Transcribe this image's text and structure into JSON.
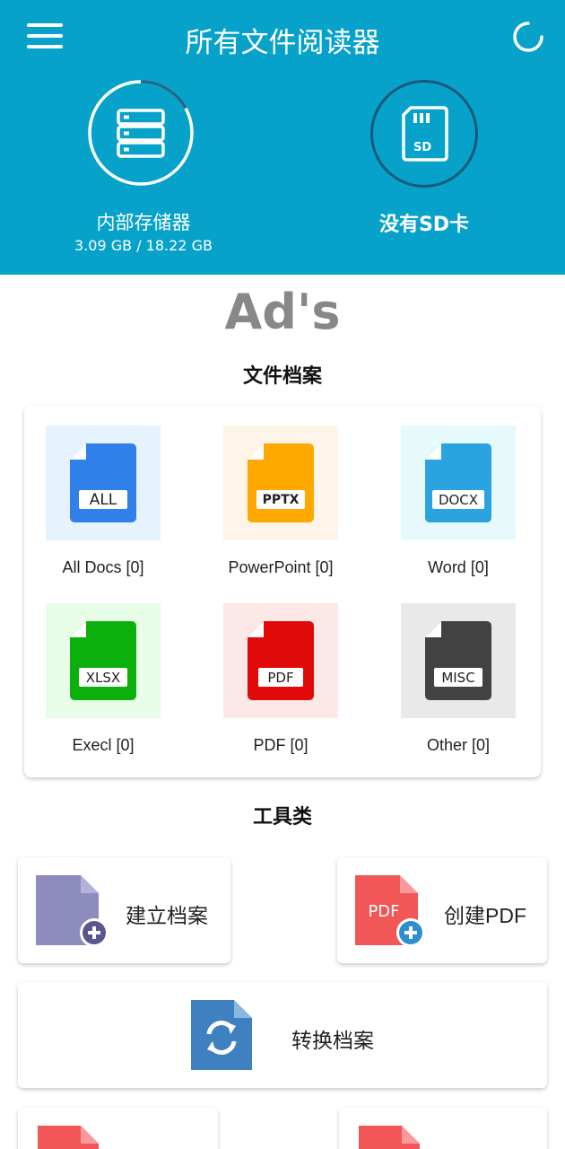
{
  "header": {
    "title": "所有文件阅读器",
    "background": "#07a2ca"
  },
  "storage": {
    "internal": {
      "label": "内部存储器",
      "usage": "3.09  GB / 18.22  GB",
      "used_fraction": 0.17
    },
    "sd": {
      "label": "没有SD卡",
      "icon_text": "SD"
    }
  },
  "ads": {
    "text": "Ad's"
  },
  "files": {
    "title": "文件档案",
    "items": [
      {
        "badge": "ALL",
        "label": "All Docs [0]",
        "color": "#2f80e8",
        "bg": "#e6f2fd"
      },
      {
        "badge": "PPTX",
        "label": "PowerPoint [0]",
        "color": "#ffa800",
        "bg": "#fff4e9"
      },
      {
        "badge": "DOCX",
        "label": "Word [0]",
        "color": "#2aa3e0",
        "bg": "#e6fafc"
      },
      {
        "badge": "XLSX",
        "label": "Execl [0]",
        "color": "#0cb00c",
        "bg": "#e8fde8"
      },
      {
        "badge": "PDF",
        "label": "PDF [0]",
        "color": "#e00a0a",
        "bg": "#fde8e8"
      },
      {
        "badge": "MISC",
        "label": "Other [0]",
        "color": "#424242",
        "bg": "#e9e9e9"
      }
    ]
  },
  "tools": {
    "title": "工具类",
    "create_file": {
      "label": "建立档案",
      "color": "#8e8bbf"
    },
    "create_pdf": {
      "label": "创建PDF",
      "icon_text": "PDF",
      "color": "#f25757"
    },
    "convert": {
      "label": "转换档案",
      "color": "#3e80c0"
    }
  }
}
